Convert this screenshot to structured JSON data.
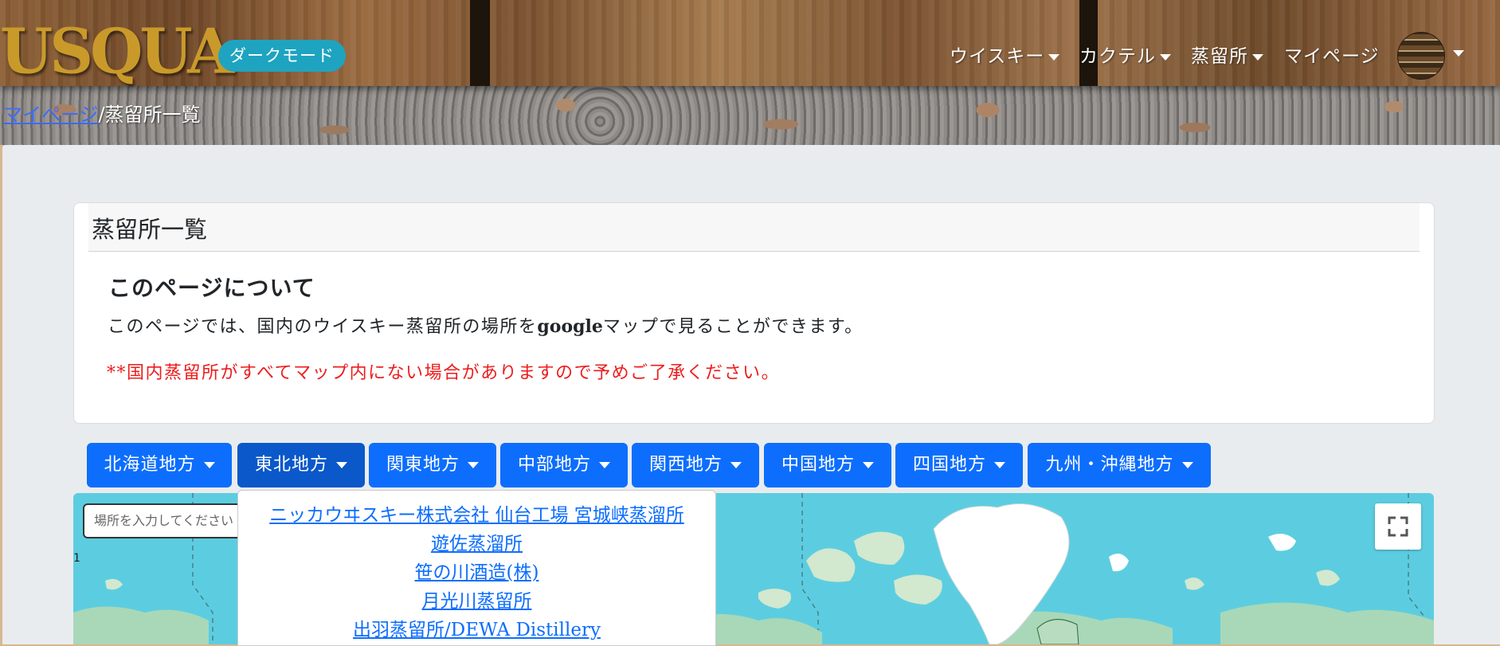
{
  "header": {
    "brand": "USQUA",
    "dark_mode_label": "ダークモード",
    "nav": [
      {
        "label": "ウイスキー"
      },
      {
        "label": "カクテル"
      },
      {
        "label": "蒸留所"
      },
      {
        "label": "マイページ"
      }
    ]
  },
  "breadcrumb": {
    "link": "マイページ",
    "separator": "/",
    "current": "蒸留所一覧"
  },
  "card": {
    "header_title": "蒸留所一覧",
    "about_title": "このページについて",
    "about_text_before": "このページでは、国内のウイスキー蒸留所の場所を",
    "about_text_bold": "google",
    "about_text_after": "マップで見ることができます。",
    "warning": "**国内蒸留所がすべてマップ内にない場合がありますので予めご了承ください。"
  },
  "regions": [
    {
      "label": "北海道地方"
    },
    {
      "label": "東北地方"
    },
    {
      "label": "関東地方"
    },
    {
      "label": "中部地方"
    },
    {
      "label": "関西地方"
    },
    {
      "label": "中国地方"
    },
    {
      "label": "四国地方"
    },
    {
      "label": "九州・沖縄地方"
    }
  ],
  "map": {
    "search_placeholder": "場所を入力してください",
    "scale_label": "1"
  },
  "dropdown": {
    "items": [
      "ニッカウヰスキー株式会社 仙台工場 宮城峡蒸溜所",
      "遊佐蒸溜所",
      "笹の川酒造(株)",
      "月光川蒸留所",
      "出羽蒸留所/DEWA Distillery"
    ]
  },
  "colors": {
    "brand_gold": "#c99a2a",
    "dark_badge": "#1ea4c0",
    "primary": "#0d6efd",
    "warning_red": "#ee1c1c",
    "map_water": "#5ccde0"
  }
}
